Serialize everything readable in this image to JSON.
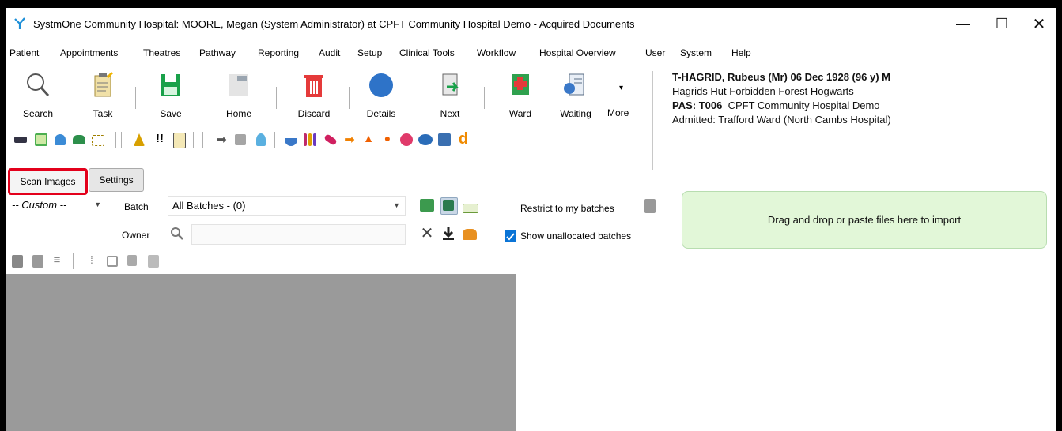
{
  "window": {
    "title": "SystmOne Community Hospital: MOORE, Megan (System Administrator) at CPFT Community Hospital Demo - Acquired Documents",
    "controls": {
      "minimize": "—",
      "maximize": "☐",
      "close": "✕"
    }
  },
  "menu": [
    "Patient",
    "Appointments",
    "Theatres",
    "Pathway",
    "Reporting",
    "Audit",
    "Setup",
    "Clinical Tools",
    "Workflow",
    "Hospital Overview",
    "User",
    "System",
    "Help"
  ],
  "toolbar": {
    "search": "Search",
    "task": "Task",
    "save": "Save",
    "home": "Home",
    "discard": "Discard",
    "details": "Details",
    "next": "Next",
    "ward": "Ward",
    "waiting": "Waiting",
    "more": "More"
  },
  "patient": {
    "name_line": "T-HAGRID, Rubeus (Mr) 06 Dec 1928 (96 y) M",
    "address": "Hagrids Hut Forbidden Forest Hogwarts",
    "pas_label": "PAS: T006",
    "pas_value": "CPFT Community Hospital Demo",
    "admitted": "Admitted: Trafford Ward (North Cambs Hospital)"
  },
  "tabs": {
    "scan_images": "Scan Images",
    "settings": "Settings"
  },
  "filters": {
    "custom_value": "-- Custom --",
    "batch_label": "Batch",
    "batch_value": "All Batches - (0)",
    "owner_label": "Owner",
    "owner_value": "",
    "restrict_label": "Restrict to my batches",
    "restrict_checked": false,
    "show_unallocated_label": "Show unallocated batches",
    "show_unallocated_checked": true
  },
  "dropzone": {
    "text": "Drag and drop or paste files here to import"
  },
  "colors": {
    "highlight": "#e3001b",
    "dropzone_bg": "#e2f7d8",
    "checkbox_blue": "#0a74d6"
  }
}
